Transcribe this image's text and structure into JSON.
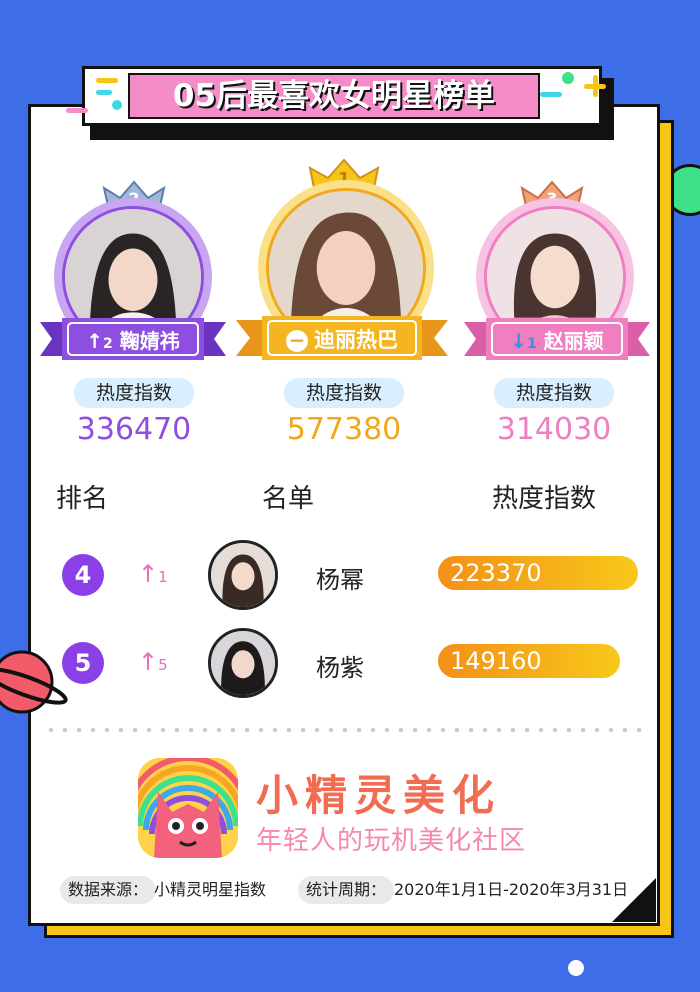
{
  "title": "05后最喜欢女明星榜单",
  "podium": [
    {
      "rank": "2",
      "name": "鞠婧祎",
      "trend_symbol": "↑",
      "trend_value": "2",
      "heat_label": "热度指数",
      "heat_value": "336470",
      "color": "#8e4fe0"
    },
    {
      "rank": "1",
      "name": "迪丽热巴",
      "trend_symbol": "−",
      "trend_value": "",
      "heat_label": "热度指数",
      "heat_value": "577380",
      "color": "#f2a81d"
    },
    {
      "rank": "3",
      "name": "赵丽颖",
      "trend_symbol": "↓",
      "trend_value": "1",
      "heat_label": "热度指数",
      "heat_value": "314030",
      "color": "#f07fc2"
    }
  ],
  "table": {
    "headers": {
      "rank": "排名",
      "name": "名单",
      "heat": "热度指数"
    },
    "rows": [
      {
        "rank": "4",
        "trend_symbol": "↑",
        "trend_value": "1",
        "name": "杨幂",
        "heat_value": "223370",
        "bar_fraction": 0.387
      },
      {
        "rank": "5",
        "trend_symbol": "↑",
        "trend_value": "5",
        "name": "杨紫",
        "heat_value": "149160",
        "bar_fraction": 0.258
      }
    ]
  },
  "brand": {
    "name": "小精灵美化",
    "slogan": "年轻人的玩机美化社区"
  },
  "footer": {
    "source_label": "数据来源：",
    "source_value": "小精灵明星指数",
    "period_label": "统计周期：",
    "period_value": "2020年1月1日-2020年3月31日"
  },
  "colors": {
    "background": "#3d6ee8",
    "accent_yellow": "#f5c518",
    "accent_pink": "#f48cc8",
    "bar_gradient_start": "#f39018",
    "bar_gradient_end": "#f8c81a"
  }
}
